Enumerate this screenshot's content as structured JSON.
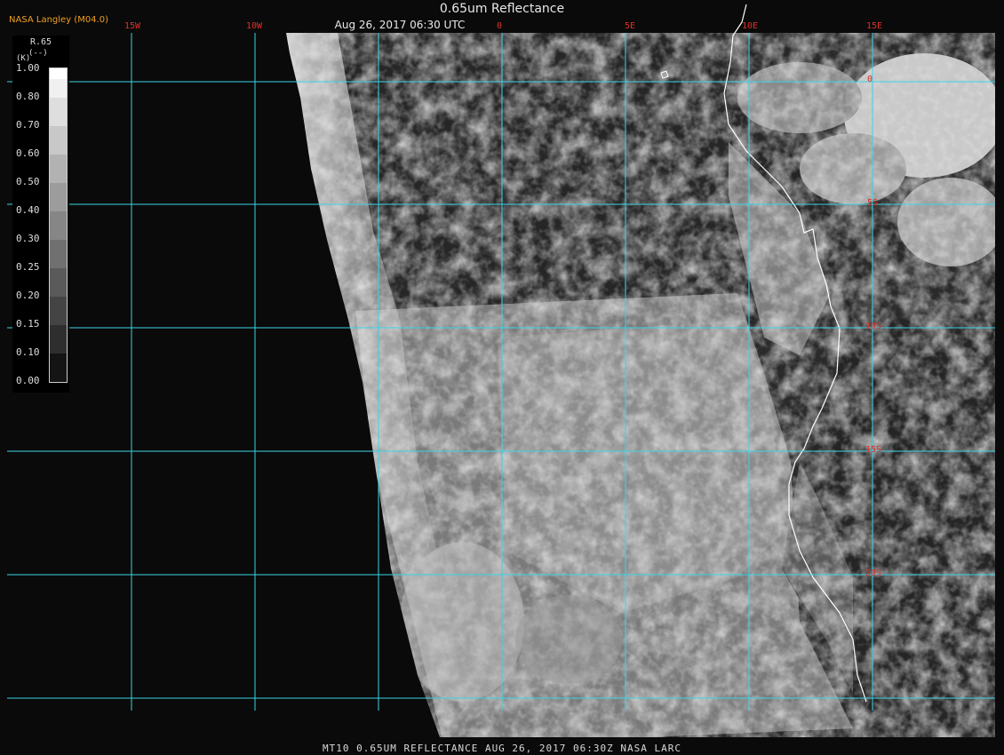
{
  "header": {
    "title": "0.65um Reflectance",
    "subtitle": "Aug 26, 2017 06:30 UTC",
    "credit": "NASA Langley (M04.0)"
  },
  "colorbar": {
    "variable": "R.65",
    "unit": "(--)",
    "index": "(K)",
    "ticks": [
      "1.00",
      "0.80",
      "0.70",
      "0.60",
      "0.50",
      "0.40",
      "0.30",
      "0.25",
      "0.20",
      "0.15",
      "0.10",
      "0.00"
    ]
  },
  "grid": {
    "lon_labels": [
      "15W",
      "10W",
      "0",
      "5E",
      "10E",
      "15E"
    ],
    "lat_labels": [
      "0",
      "5S",
      "10S",
      "15S",
      "20S"
    ],
    "color": "#39d4e6"
  },
  "colors": {
    "label": "#e0302a",
    "credit": "#f0a020",
    "coastline": "#ffffff"
  },
  "footer": {
    "text": "MT10  0.65UM REFLECTANCE   AUG 26, 2017 06:30Z   NASA LARC"
  }
}
